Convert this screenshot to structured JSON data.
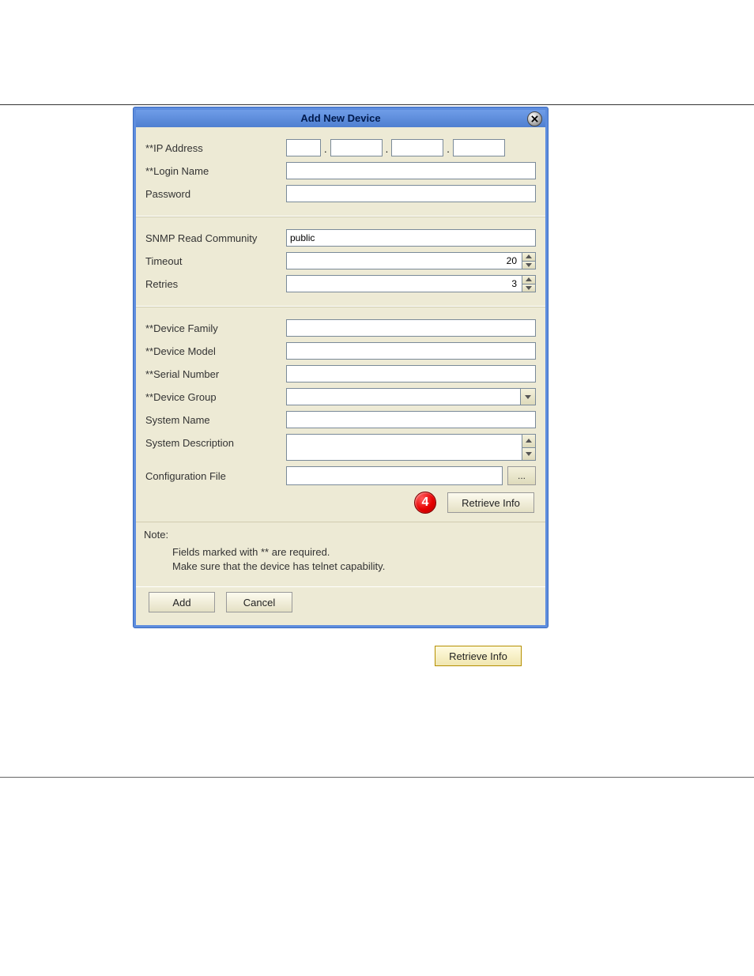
{
  "dialog": {
    "title": "Add New Device",
    "sections": {
      "conn": {
        "ip_label": "**IP Address",
        "ip": {
          "a": "",
          "b": "",
          "c": "",
          "d": ""
        },
        "login_label": "**Login Name",
        "login_value": "",
        "password_label": "Password",
        "password_value": ""
      },
      "snmp": {
        "community_label": "SNMP Read Community",
        "community_value": "public",
        "timeout_label": "Timeout",
        "timeout_value": "20",
        "retries_label": "Retries",
        "retries_value": "3"
      },
      "device": {
        "family_label": "**Device Family",
        "family_value": "",
        "model_label": "**Device Model",
        "model_value": "",
        "serial_label": "**Serial Number",
        "serial_value": "",
        "group_label": "**Device Group",
        "group_value": "",
        "sysname_label": "System Name",
        "sysname_value": "",
        "sysdesc_label": "System Description",
        "sysdesc_value": "",
        "config_label": "Configuration File",
        "config_value": "",
        "browse_label": "...",
        "retrieve_label": "Retrieve Info"
      }
    },
    "callout": "4",
    "note": {
      "heading": "Note:",
      "line1": "Fields marked with ** are required.",
      "line2": "Make sure that the device has telnet capability."
    },
    "buttons": {
      "add": "Add",
      "cancel": "Cancel"
    }
  },
  "external": {
    "retrieve_label": "Retrieve Info"
  }
}
